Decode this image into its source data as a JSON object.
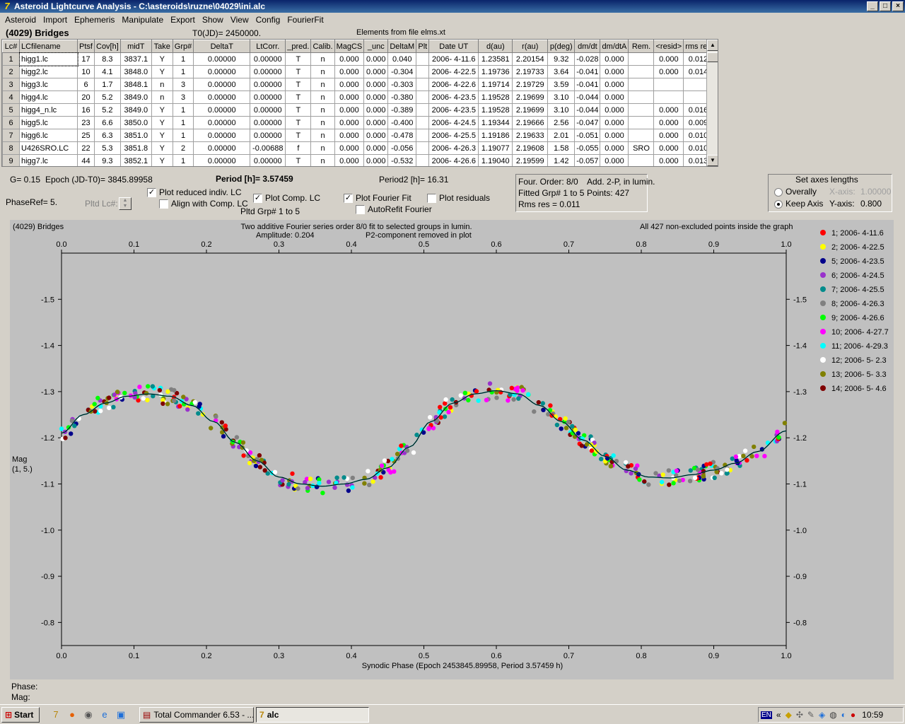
{
  "window": {
    "title": "Asteroid Lightcurve Analysis - C:\\asteroids\\ruzne\\04029\\ini.alc",
    "buttons": [
      "_",
      "□",
      "×"
    ]
  },
  "menu": [
    "Asteroid",
    "Import",
    "Ephemeris",
    "Manipulate",
    "Export",
    "Show",
    "View",
    "Config",
    "FourierFit"
  ],
  "header": {
    "object": "(4029) Bridges",
    "t0": "T0(JD)= 2450000.",
    "elements": "Elements from file elms.xt"
  },
  "table": {
    "columns": [
      "Lc#",
      "LCfilename",
      "Ptsf",
      "Cov[h]",
      "midT",
      "Take",
      "Grp#",
      "DeltaT",
      "LtCorr.",
      "_pred.",
      "Calib.",
      "MagCS",
      "_unc",
      "DeltaM",
      "Plt",
      "Date UT",
      "d(au)",
      "r(au)",
      "p(deg)",
      "dm/dt",
      "dm/dtA",
      "Rem.",
      "<resid>",
      "rms res"
    ],
    "rows": [
      [
        "1",
        "higg1.lc",
        "17",
        "8.3",
        "3837.1",
        "Y",
        "1",
        "0.00000",
        "0.00000",
        "T",
        "n",
        "0.000",
        "0.000",
        "0.040",
        "",
        "2006- 4-11.6",
        "1.23581",
        "2.20154",
        "9.32",
        "-0.028",
        "0.000",
        "",
        "0.000",
        "0.012"
      ],
      [
        "2",
        "higg2.lc",
        "10",
        "4.1",
        "3848.0",
        "Y",
        "1",
        "0.00000",
        "0.00000",
        "T",
        "n",
        "0.000",
        "0.000",
        "-0.304",
        "",
        "2006- 4-22.5",
        "1.19736",
        "2.19733",
        "3.64",
        "-0.041",
        "0.000",
        "",
        "0.000",
        "0.014"
      ],
      [
        "3",
        "higg3.lc",
        "6",
        "1.7",
        "3848.1",
        "n",
        "3",
        "0.00000",
        "0.00000",
        "T",
        "n",
        "0.000",
        "0.000",
        "-0.303",
        "",
        "2006- 4-22.6",
        "1.19714",
        "2.19729",
        "3.59",
        "-0.041",
        "0.000",
        "",
        "",
        ""
      ],
      [
        "4",
        "higg4.lc",
        "20",
        "5.2",
        "3849.0",
        "n",
        "3",
        "0.00000",
        "0.00000",
        "T",
        "n",
        "0.000",
        "0.000",
        "-0.380",
        "",
        "2006- 4-23.5",
        "1.19528",
        "2.19699",
        "3.10",
        "-0.044",
        "0.000",
        "",
        "",
        ""
      ],
      [
        "5",
        "higg4_n.lc",
        "16",
        "5.2",
        "3849.0",
        "Y",
        "1",
        "0.00000",
        "0.00000",
        "T",
        "n",
        "0.000",
        "0.000",
        "-0.389",
        "",
        "2006- 4-23.5",
        "1.19528",
        "2.19699",
        "3.10",
        "-0.044",
        "0.000",
        "",
        "0.000",
        "0.016"
      ],
      [
        "6",
        "higg5.lc",
        "23",
        "6.6",
        "3850.0",
        "Y",
        "1",
        "0.00000",
        "0.00000",
        "T",
        "n",
        "0.000",
        "0.000",
        "-0.400",
        "",
        "2006- 4-24.5",
        "1.19344",
        "2.19666",
        "2.56",
        "-0.047",
        "0.000",
        "",
        "0.000",
        "0.009"
      ],
      [
        "7",
        "higg6.lc",
        "25",
        "6.3",
        "3851.0",
        "Y",
        "1",
        "0.00000",
        "0.00000",
        "T",
        "n",
        "0.000",
        "0.000",
        "-0.478",
        "",
        "2006- 4-25.5",
        "1.19186",
        "2.19633",
        "2.01",
        "-0.051",
        "0.000",
        "",
        "0.000",
        "0.010"
      ],
      [
        "8",
        "U426SRO.LC",
        "22",
        "5.3",
        "3851.8",
        "Y",
        "2",
        "0.00000",
        "-0.00688",
        "f",
        "n",
        "0.000",
        "0.000",
        "-0.056",
        "",
        "2006- 4-26.3",
        "1.19077",
        "2.19608",
        "1.58",
        "-0.055",
        "0.000",
        "SRO",
        "0.000",
        "0.010"
      ],
      [
        "9",
        "higg7.lc",
        "44",
        "9.3",
        "3852.1",
        "Y",
        "1",
        "0.00000",
        "0.00000",
        "T",
        "n",
        "0.000",
        "0.000",
        "-0.532",
        "",
        "2006- 4-26.6",
        "1.19040",
        "2.19599",
        "1.42",
        "-0.057",
        "0.000",
        "",
        "0.000",
        "0.013"
      ]
    ]
  },
  "params": {
    "g": "G= 0.15",
    "epoch": "Epoch (JD-T0)= 3845.89958",
    "period": "Period [h]= 3.57459",
    "period2": "Period2 [h]= 16.31",
    "phaseref": "PhaseRef= 5.",
    "pltdlc": "Pltd Lc#:",
    "pltd_grp": "Pltd Grp#   1   to   5"
  },
  "checks": {
    "reduced": {
      "label": "Plot reduced indiv. LC",
      "checked": true
    },
    "align": {
      "label": "Align with Comp. LC",
      "checked": false
    },
    "comp": {
      "label": "Plot Comp. LC",
      "checked": true
    },
    "fourier": {
      "label": "Plot Fourier Fit",
      "checked": true
    },
    "autorefit": {
      "label": "AutoRefit Fourier",
      "checked": false
    },
    "residuals": {
      "label": "Plot residuals",
      "checked": false
    }
  },
  "fitinfo": {
    "order": "Four. Order:  8/0",
    "add": "Add. 2-P, in lumin.",
    "grp": "Fitted Grp# 1 to 5",
    "points": "Points: 427",
    "rms": "Rms res      = 0.011"
  },
  "axes_box": {
    "title": "Set axes lengths",
    "overall": "Overally",
    "keep": "Keep Axis",
    "xaxis_label": "X-axis:",
    "xaxis_val": "1.00000",
    "yaxis_label": "Y-axis:",
    "yaxis_val": "0.800"
  },
  "footer": {
    "phase": "Phase:",
    "mag": "Mag:"
  },
  "taskbar": {
    "start": "Start",
    "task1": "Total Commander 6.53 - ...",
    "task2": "alc",
    "lang": "EN",
    "clock": "10:59"
  },
  "chart_data": {
    "type": "scatter",
    "title_left": "(4029) Bridges",
    "title_center1": "Two additive Fourier series order 8/0 fit to selected groups in lumin.",
    "title_center2a": "Amplitude: 0.204",
    "title_center2b": "P2-component removed in plot",
    "title_right": "All 427 non-excluded points inside the graph",
    "xlabel": "Synodic Phase (Epoch 2453845.89958, Period 3.57459 h)",
    "ylabel_1": "Mag",
    "ylabel_2": "(1, 5.)",
    "xlim": [
      0,
      1
    ],
    "ylim": [
      -1.6,
      -0.75
    ],
    "y_inverted": true,
    "x_ticks": [
      "0.0",
      "0.1",
      "0.2",
      "0.3",
      "0.4",
      "0.5",
      "0.6",
      "0.7",
      "0.8",
      "0.9",
      "1.0"
    ],
    "y_ticks": [
      "-1.5",
      "-1.4",
      "-1.3",
      "-1.2",
      "-1.1",
      "-1.0",
      "-0.9",
      "-0.8"
    ],
    "fit_curve": {
      "phase": [
        0.0,
        0.03,
        0.06,
        0.09,
        0.12,
        0.15,
        0.18,
        0.21,
        0.24,
        0.27,
        0.3,
        0.33,
        0.36,
        0.39,
        0.42,
        0.45,
        0.48,
        0.51,
        0.54,
        0.57,
        0.6,
        0.63,
        0.66,
        0.69,
        0.72,
        0.75,
        0.78,
        0.81,
        0.84,
        0.87,
        0.9,
        0.93,
        0.96,
        1.0
      ],
      "mag": [
        -1.21,
        -1.25,
        -1.275,
        -1.29,
        -1.295,
        -1.29,
        -1.27,
        -1.235,
        -1.19,
        -1.15,
        -1.115,
        -1.1,
        -1.095,
        -1.1,
        -1.11,
        -1.135,
        -1.18,
        -1.235,
        -1.275,
        -1.295,
        -1.302,
        -1.295,
        -1.27,
        -1.235,
        -1.195,
        -1.16,
        -1.13,
        -1.115,
        -1.113,
        -1.12,
        -1.13,
        -1.145,
        -1.17,
        -1.215
      ]
    },
    "series": [
      {
        "name": "1; 2006- 4-11.6",
        "color": "#ff0000"
      },
      {
        "name": "2; 2006- 4-22.5",
        "color": "#ffff00"
      },
      {
        "name": "5; 2006- 4-23.5",
        "color": "#00008b"
      },
      {
        "name": "6; 2006- 4-24.5",
        "color": "#9932cc"
      },
      {
        "name": "7; 2006- 4-25.5",
        "color": "#008b8b"
      },
      {
        "name": "8; 2006- 4-26.3",
        "color": "#808080"
      },
      {
        "name": "9; 2006- 4-26.6",
        "color": "#00ff00"
      },
      {
        "name": "10; 2006- 4-27.7",
        "color": "#ff00ff"
      },
      {
        "name": "11; 2006- 4-29.3",
        "color": "#00ffff"
      },
      {
        "name": "12; 2006- 5- 2.3",
        "color": "#ffffff"
      },
      {
        "name": "13; 2006- 5- 3.3",
        "color": "#808000"
      },
      {
        "name": "14; 2006- 5- 4.6",
        "color": "#800000"
      }
    ],
    "points_count": 427,
    "grid": false,
    "legend_position": "right"
  }
}
